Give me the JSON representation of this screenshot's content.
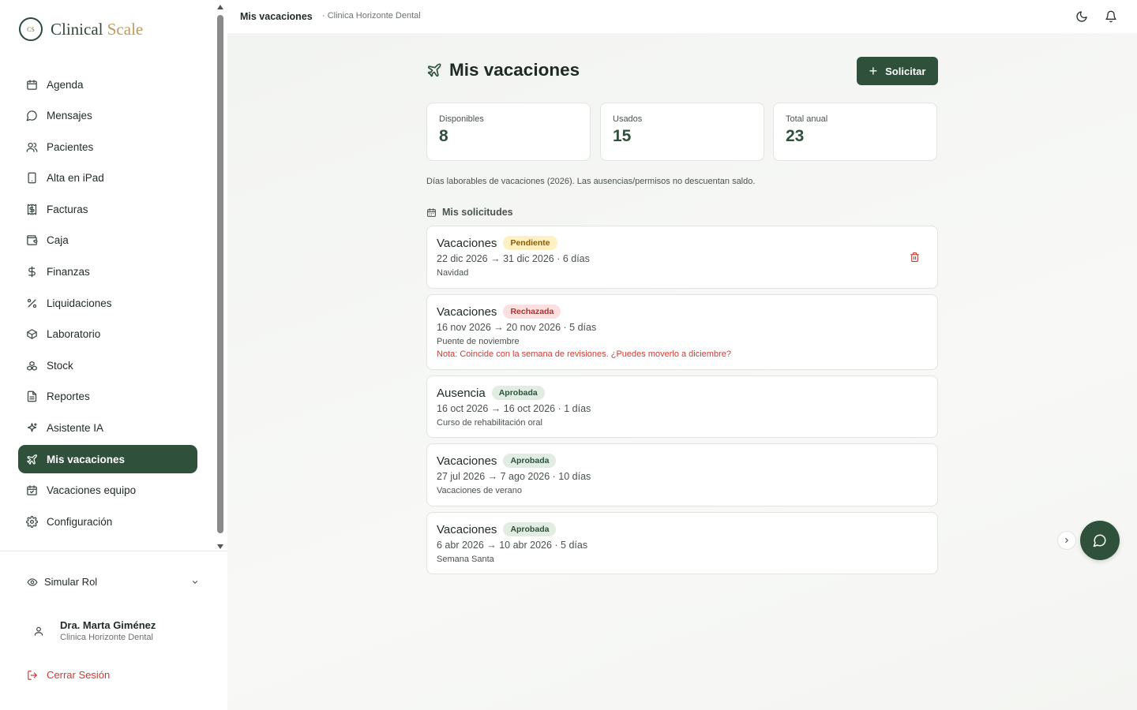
{
  "brand": {
    "mark_text": "CS",
    "name_primary": "Clinical",
    "name_accent": "Scale"
  },
  "topbar": {
    "title": "Mis vacaciones",
    "subtitle": "· Clinica Horizonte Dental"
  },
  "sidebar": {
    "items": [
      {
        "label": "Agenda",
        "icon": "calendar-icon"
      },
      {
        "label": "Mensajes",
        "icon": "message-icon"
      },
      {
        "label": "Pacientes",
        "icon": "users-icon"
      },
      {
        "label": "Alta en iPad",
        "icon": "tablet-icon"
      },
      {
        "label": "Facturas",
        "icon": "receipt-icon"
      },
      {
        "label": "Caja",
        "icon": "wallet-icon"
      },
      {
        "label": "Finanzas",
        "icon": "dollar-icon"
      },
      {
        "label": "Liquidaciones",
        "icon": "percent-icon"
      },
      {
        "label": "Laboratorio",
        "icon": "package-icon"
      },
      {
        "label": "Stock",
        "icon": "boxes-icon"
      },
      {
        "label": "Reportes",
        "icon": "file-icon"
      },
      {
        "label": "Asistente IA",
        "icon": "sparkles-icon"
      },
      {
        "label": "Mis vacaciones",
        "icon": "plane-icon",
        "active": true
      },
      {
        "label": "Vacaciones equipo",
        "icon": "calendar-check-icon"
      },
      {
        "label": "Configuración",
        "icon": "gear-icon"
      }
    ],
    "simular_label": "Simular Rol",
    "user_name": "Dra. Marta Giménez",
    "user_clinic": "Clinica Horizonte Dental",
    "logout_label": "Cerrar Sesión"
  },
  "main": {
    "title": "Mis vacaciones",
    "solicitar_label": "Solicitar",
    "stats": [
      {
        "label": "Disponibles",
        "value": "8"
      },
      {
        "label": "Usados",
        "value": "15"
      },
      {
        "label": "Total anual",
        "value": "23"
      }
    ],
    "note": "Días laborables de vacaciones (2026). Las ausencias/permisos no descuentan saldo.",
    "section_title": "Mis solicitudes",
    "requests": [
      {
        "type": "Vacaciones",
        "status": "Pendiente",
        "dates": "22 dic 2026 → 31 dic 2026 · 6 días",
        "note": "Navidad",
        "admin_note": ""
      },
      {
        "type": "Vacaciones",
        "status": "Rechazada",
        "dates": "16 nov 2026 → 20 nov 2026 · 5 días",
        "note": "Puente de noviembre",
        "admin_note": "Nota: Coincide con la semana de revisiones. ¿Puedes moverlo a diciembre?"
      },
      {
        "type": "Ausencia",
        "status": "Aprobada",
        "dates": "16 oct 2026 → 16 oct 2026 · 1 días",
        "note": "Curso de rehabilitación oral",
        "admin_note": ""
      },
      {
        "type": "Vacaciones",
        "status": "Aprobada",
        "dates": "27 jul 2026 → 7 ago 2026 · 10 días",
        "note": "Vacaciones de verano",
        "admin_note": ""
      },
      {
        "type": "Vacaciones",
        "status": "Aprobada",
        "dates": "6 abr 2026 → 10 abr 2026 · 5 días",
        "note": "Semana Santa",
        "admin_note": ""
      }
    ]
  },
  "colors": {
    "primary": "#2f513c",
    "accent": "#c19a5b",
    "danger": "#d23a34",
    "badge_pendiente_bg": "#fdf0c2",
    "badge_pendiente_fg": "#8a5a0b",
    "badge_rechazada_bg": "#fbe0df",
    "badge_rechazada_fg": "#b4302b",
    "badge_aprobada_bg": "#e1ece3",
    "badge_aprobada_fg": "#2f513c"
  }
}
